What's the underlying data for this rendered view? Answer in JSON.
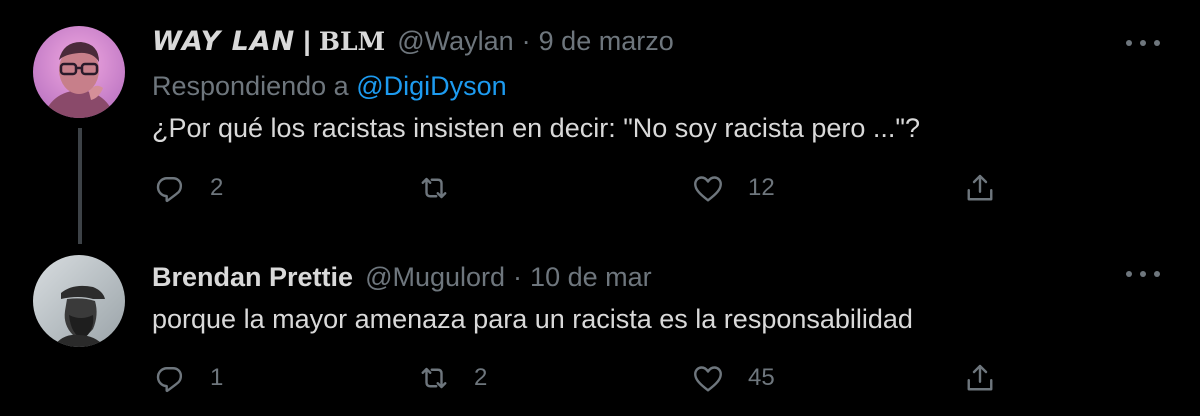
{
  "tweets": [
    {
      "display_name": "WAY LAN",
      "name_separator": "|",
      "name_tag": "BLM",
      "handle": "@Waylan",
      "separator": "·",
      "timestamp": "9 de marzo",
      "reply_prefix": "Respondiendo a",
      "reply_to": "@DigiDyson",
      "text": "¿Por qué los racistas insisten en decir: \"No soy racista pero ...\"?",
      "reply_count": "2",
      "retweet_count": "",
      "like_count": "12",
      "avatar_icon": "person-avatar-pink-light"
    },
    {
      "display_name": "Brendan Prettie",
      "handle": "@Mugulord",
      "separator": "·",
      "timestamp": "10 de mar",
      "text": "porque la mayor amenaza para un racista es la responsabilidad",
      "reply_count": "1",
      "retweet_count": "2",
      "like_count": "45",
      "avatar_icon": "person-avatar-silhouette-beard"
    }
  ],
  "icons": {
    "reply": "speech-bubble-icon",
    "retweet": "retweet-arrows-icon",
    "like": "heart-icon",
    "share": "share-upload-icon",
    "more": "more-dots-icon"
  },
  "colors": {
    "background": "#000000",
    "primary_text": "#d9d9d9",
    "secondary_text": "#6e767d",
    "link": "#1d9bf0",
    "thread_line": "#3d4247"
  }
}
